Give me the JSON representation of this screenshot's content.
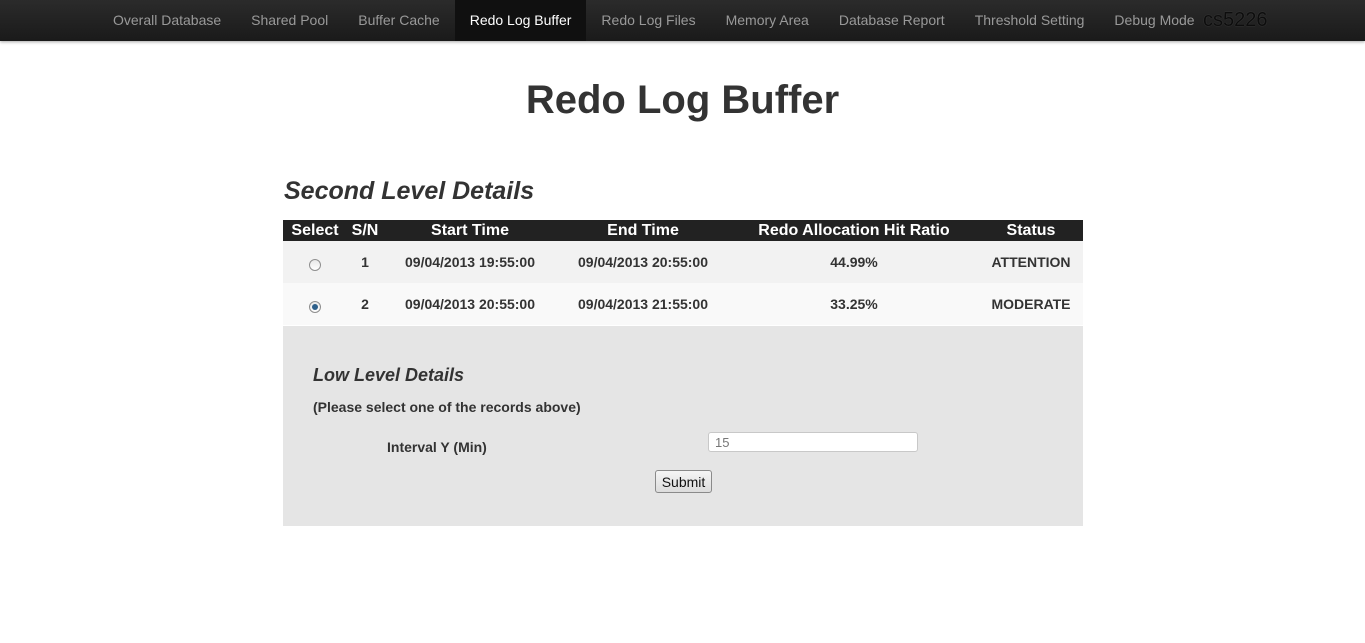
{
  "nav": {
    "items": [
      {
        "label": "Overall Database"
      },
      {
        "label": "Shared Pool"
      },
      {
        "label": "Buffer Cache"
      },
      {
        "label": "Redo Log Buffer",
        "active": true
      },
      {
        "label": "Redo Log Files"
      },
      {
        "label": "Memory Area"
      },
      {
        "label": "Database Report"
      },
      {
        "label": "Threshold Setting"
      },
      {
        "label": "Debug Mode"
      }
    ],
    "brand": "cs5226"
  },
  "page": {
    "title": "Redo Log Buffer"
  },
  "second_level": {
    "title": "Second Level Details",
    "columns": [
      "Select",
      "S/N",
      "Start Time",
      "End Time",
      "Redo Allocation Hit Ratio",
      "Status"
    ],
    "rows": [
      {
        "selected": false,
        "sn": "1",
        "start": "09/04/2013 19:55:00",
        "end": "09/04/2013 20:55:00",
        "ratio": "44.99%",
        "status": "ATTENTION"
      },
      {
        "selected": true,
        "sn": "2",
        "start": "09/04/2013 20:55:00",
        "end": "09/04/2013 21:55:00",
        "ratio": "33.25%",
        "status": "MODERATE"
      }
    ]
  },
  "low_level": {
    "title": "Low Level Details",
    "hint": "(Please select one of the records above)",
    "interval_label": "Interval Y (Min)",
    "interval_value": "15",
    "submit_label": "Submit"
  },
  "colors": {
    "navbar": "#1f1f1f",
    "attention": "#cc1111",
    "moderate": "#f0b429",
    "panel": "#e5e5e5"
  }
}
